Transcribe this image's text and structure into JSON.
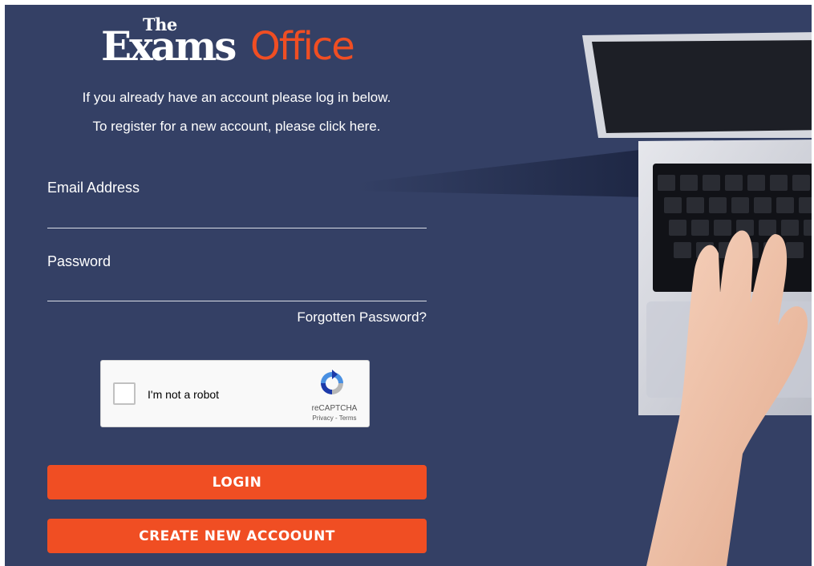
{
  "brand": {
    "the": "The",
    "exams": "Exams",
    "office": "Office",
    "accent_color": "#f04e23",
    "background_color": "#344065"
  },
  "intro": {
    "line1": "If you already have an account please log in below.",
    "line2": "To register for a new account, please click here."
  },
  "form": {
    "email_label": "Email Address",
    "email_value": "",
    "password_label": "Password",
    "password_value": "",
    "forgot_link": "Forgotten Password?"
  },
  "recaptcha": {
    "checkbox_label": "I'm not a robot",
    "brand": "reCAPTCHA",
    "links": "Privacy - Terms",
    "icon": "recaptcha-icon"
  },
  "buttons": {
    "login": "LOGIN",
    "create": "CREATE NEW ACCOOUNT"
  },
  "image": {
    "description_icon": "laptop-typing-hand-image"
  }
}
